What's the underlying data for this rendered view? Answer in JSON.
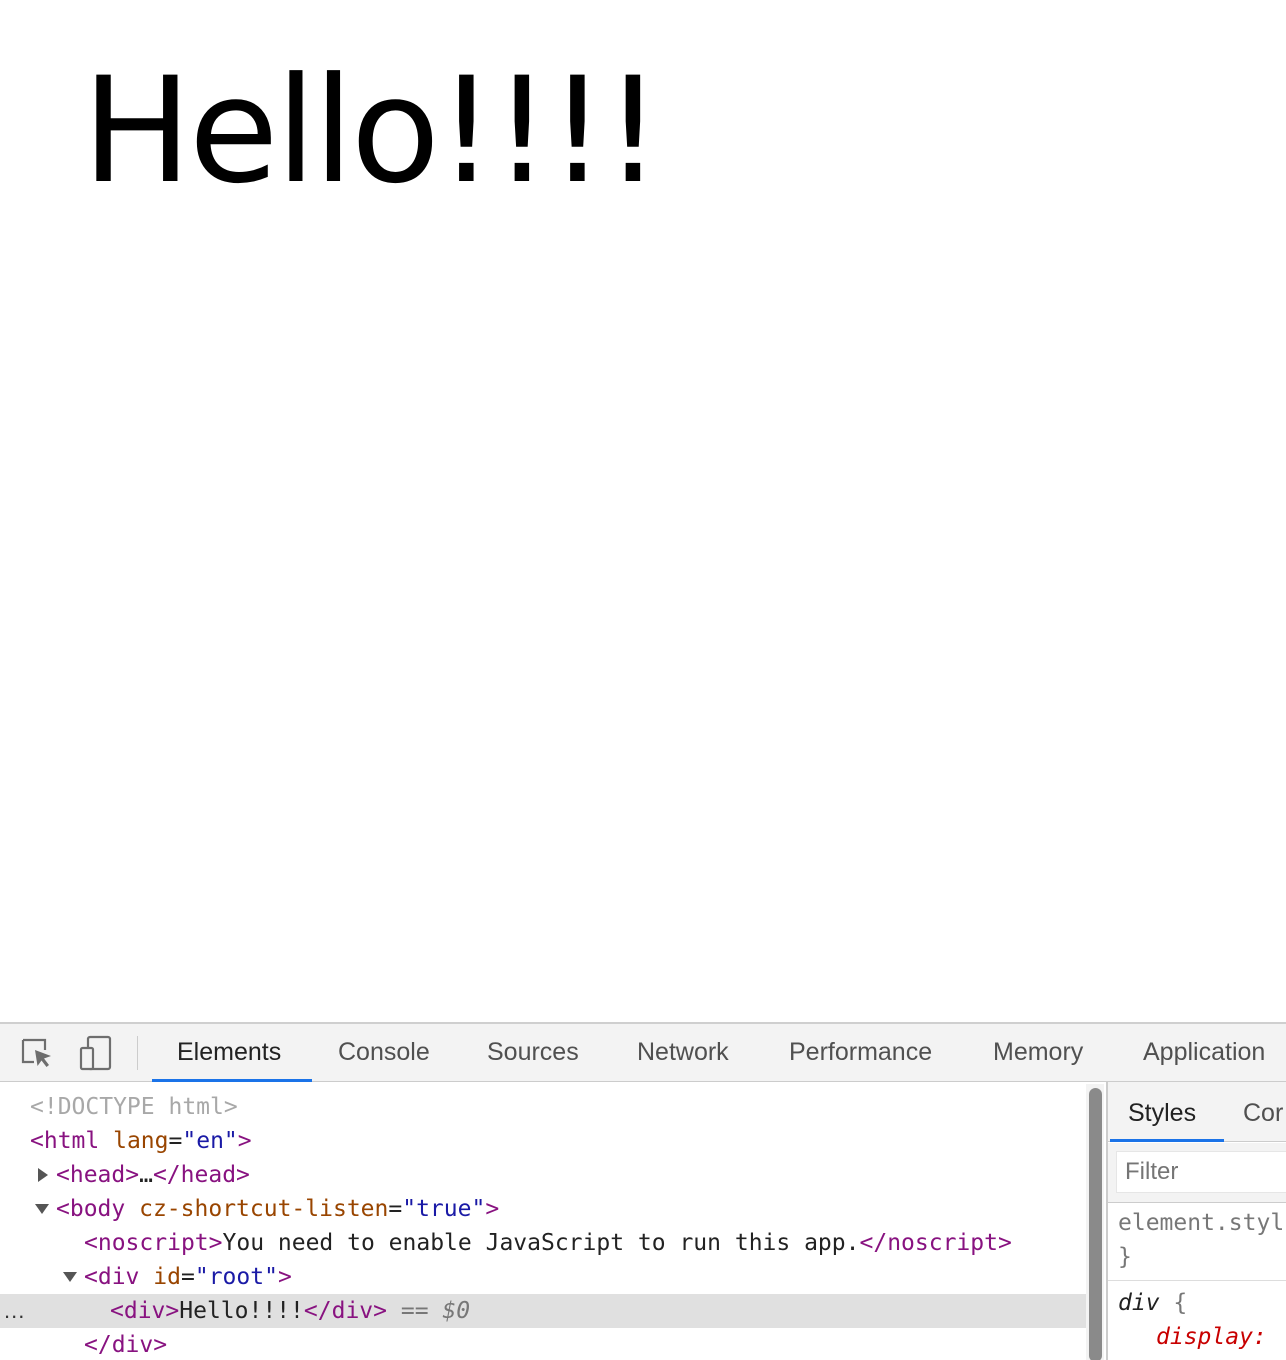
{
  "page": {
    "heading": "Hello!!!!"
  },
  "devtools": {
    "toolbar": {
      "inspect_icon": "inspect-element-icon",
      "device_icon": "device-toolbar-icon",
      "tabs": [
        {
          "label": "Elements",
          "active": true
        },
        {
          "label": "Console",
          "active": false
        },
        {
          "label": "Sources",
          "active": false
        },
        {
          "label": "Network",
          "active": false
        },
        {
          "label": "Performance",
          "active": false
        },
        {
          "label": "Memory",
          "active": false
        },
        {
          "label": "Application",
          "active": false
        }
      ]
    },
    "elements": {
      "doctype": "<!DOCTYPE html>",
      "html_open": {
        "tag": "html",
        "attr": "lang",
        "value": "en"
      },
      "head": {
        "open": "<head>",
        "ellipsis": "…",
        "close": "</head>"
      },
      "body_open": {
        "tag": "body",
        "attr": "cz-shortcut-listen",
        "value": "true"
      },
      "noscript": {
        "open_tag": "noscript",
        "text": "You need to enable JavaScript to run this app.",
        "close_tag": "/noscript"
      },
      "root_div": {
        "tag": "div",
        "attr": "id",
        "value": "root"
      },
      "selected_div": {
        "open_tag": "div",
        "text": "Hello!!!!",
        "close_tag": "/div",
        "marker": "== $0",
        "dots": "..."
      },
      "close_div": "</div>"
    },
    "styles_pane": {
      "tabs": [
        {
          "label": "Styles",
          "active": true
        },
        {
          "label": "Cor",
          "active": false
        }
      ],
      "filter_placeholder": "Filter",
      "rules": [
        {
          "selector": "element.styl",
          "close": "}"
        },
        {
          "selector": "div",
          "open": "{",
          "property": "display:"
        }
      ]
    }
  }
}
